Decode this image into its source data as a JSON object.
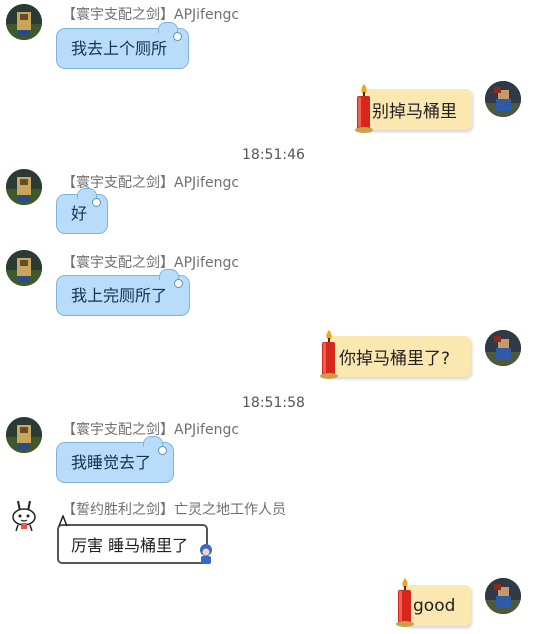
{
  "messages": [
    {
      "type": "incoming",
      "sender": "【寰宇支配之剑】APJifengc",
      "text": "我去上个厕所"
    },
    {
      "type": "outgoing",
      "text": "别掉马桶里"
    },
    {
      "type": "timestamp",
      "text": "18:51:46"
    },
    {
      "type": "incoming",
      "sender": "【寰宇支配之剑】APJifengc",
      "text": "好"
    },
    {
      "type": "incoming",
      "sender": "【寰宇支配之剑】APJifengc",
      "text": "我上完厕所了"
    },
    {
      "type": "outgoing",
      "text": "你掉马桶里了?"
    },
    {
      "type": "timestamp",
      "text": "18:51:58"
    },
    {
      "type": "incoming",
      "sender": "【寰宇支配之剑】APJifengc",
      "text": "我睡觉去了"
    },
    {
      "type": "incoming",
      "sender": "【誓约胜利之剑】亡灵之地工作人员",
      "text": "厉害 睡马桶里了"
    },
    {
      "type": "outgoing",
      "text": "good"
    }
  ],
  "colors": {
    "incoming_bubble": "#b9dcfa",
    "outgoing_bubble": "#fbe7b0",
    "candle": "#d7261b"
  }
}
